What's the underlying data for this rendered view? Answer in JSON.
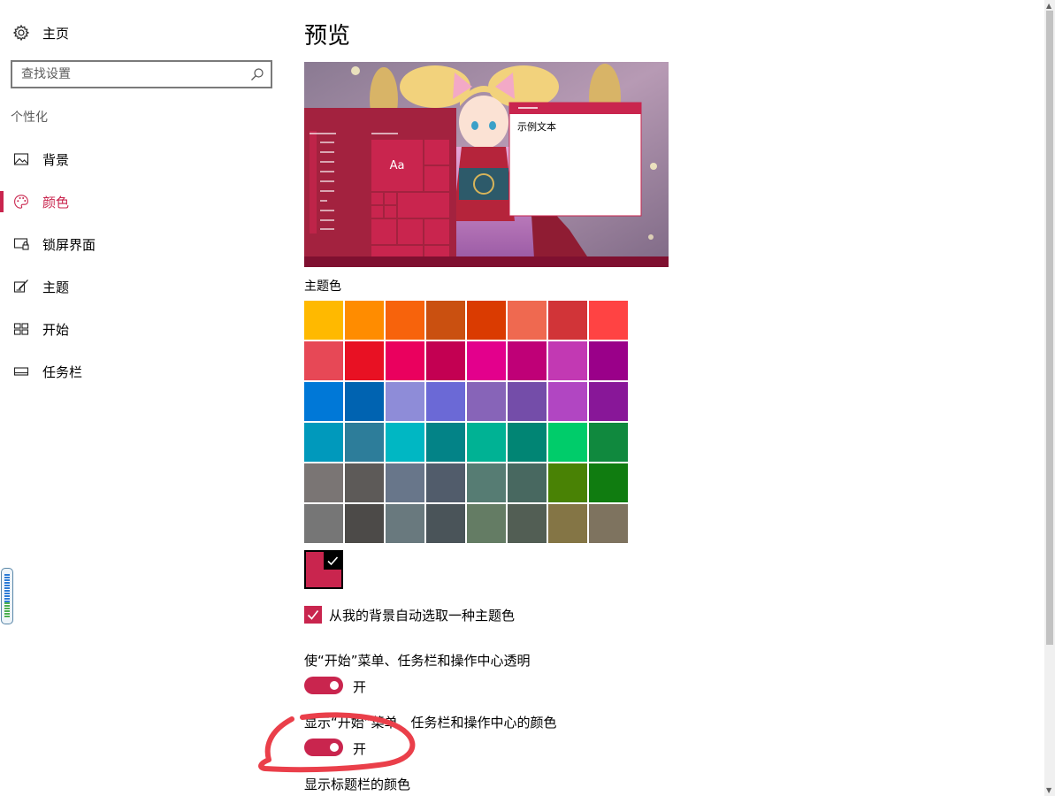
{
  "sidebar": {
    "home_label": "主页",
    "search": {
      "placeholder": "查找设置",
      "value": ""
    },
    "section_label": "个性化",
    "items": [
      {
        "label": "背景",
        "icon": "picture-icon",
        "active": false
      },
      {
        "label": "颜色",
        "icon": "palette-icon",
        "active": true
      },
      {
        "label": "锁屏界面",
        "icon": "lock-screen-icon",
        "active": false
      },
      {
        "label": "主题",
        "icon": "theme-brush-icon",
        "active": false
      },
      {
        "label": "开始",
        "icon": "start-tiles-icon",
        "active": false
      },
      {
        "label": "任务栏",
        "icon": "taskbar-icon",
        "active": false
      }
    ]
  },
  "main": {
    "title": "预览",
    "preview": {
      "sample_text": "示例文本",
      "tile_text": "Aa"
    },
    "accent_label": "主题色",
    "accent_color": "#c9254e",
    "swatch_rows": [
      [
        "#ffb900",
        "#ff8c00",
        "#f7630c",
        "#ca5010",
        "#da3b01",
        "#ef6950",
        "#d13438",
        "#ff4343"
      ],
      [
        "#e74856",
        "#e81123",
        "#ea005e",
        "#c30052",
        "#e3008c",
        "#bf0077",
        "#c239b3",
        "#9a0089"
      ],
      [
        "#0078d7",
        "#0063b1",
        "#8e8cd8",
        "#6b69d6",
        "#8764b8",
        "#744da9",
        "#b146c2",
        "#881798"
      ],
      [
        "#0099bc",
        "#2d7d9a",
        "#00b7c3",
        "#038387",
        "#00b294",
        "#018574",
        "#00cc6a",
        "#10893e"
      ],
      [
        "#7a7574",
        "#5d5a58",
        "#68768a",
        "#515c6b",
        "#567c73",
        "#486860",
        "#498205",
        "#107c10"
      ],
      [
        "#767676",
        "#4c4a48",
        "#69797e",
        "#4a5459",
        "#647c64",
        "#525e54",
        "#847545",
        "#7e735f"
      ]
    ],
    "custom_color": "#c9254e",
    "auto_pick_label": "从我的背景自动选取一种主题色",
    "auto_pick_checked": true,
    "transparency": {
      "label": "使“开始”菜单、任务栏和操作中心透明",
      "state": "开",
      "on": true
    },
    "show_color": {
      "label": "显示“开始”菜单、任务栏和操作中心的颜色",
      "state": "开",
      "on": true
    },
    "title_bar_label": "显示标题栏的颜色"
  }
}
